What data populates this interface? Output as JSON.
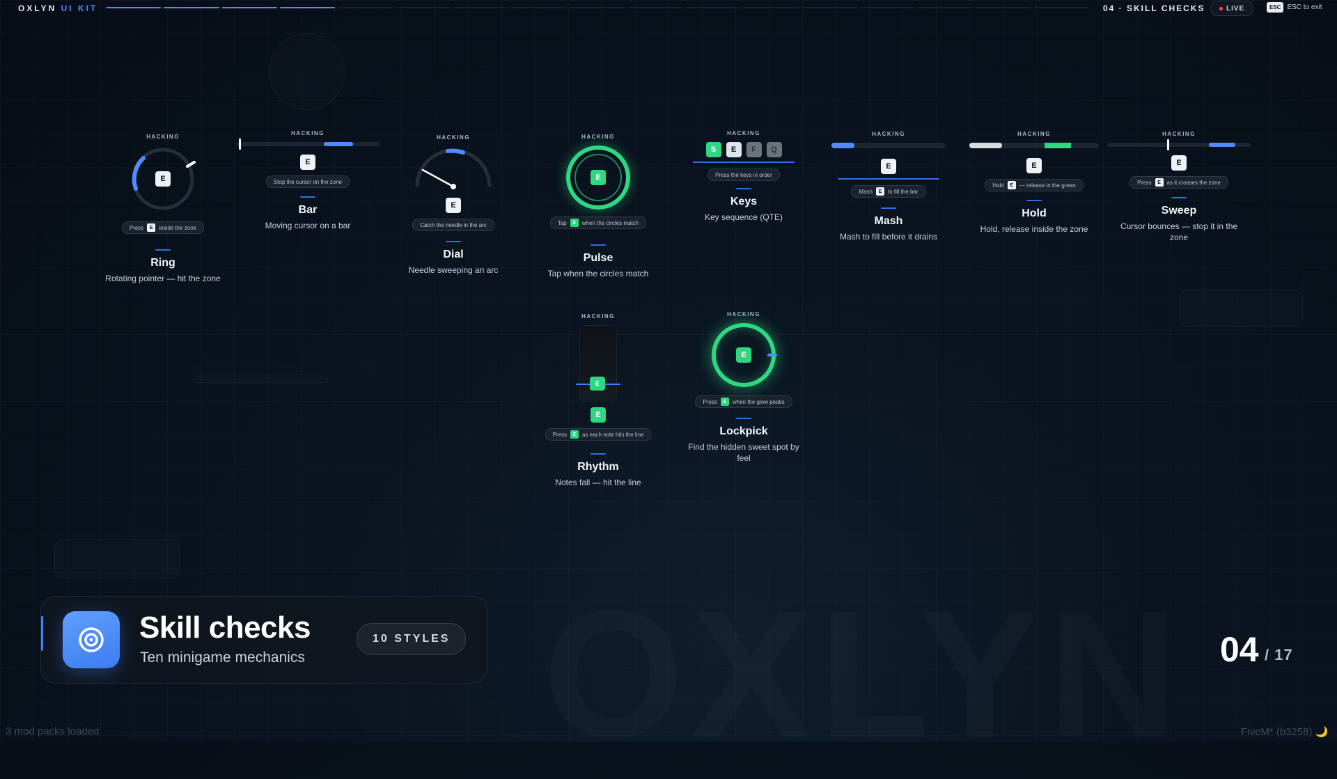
{
  "topbar": {
    "brand": "OXLYN",
    "brand_accent": "UI KIT",
    "section": "04 · SKILL CHECKS",
    "live": "LIVE",
    "esc_key": "ESC",
    "esc_label": "ESC to exit",
    "progress_total": 17,
    "progress_current": 4
  },
  "widgets": [
    {
      "id": "ring",
      "label": "HACKING",
      "key": "E",
      "hint_pre": "Press",
      "hint_key": "E",
      "hint_post": "inside the zone",
      "title": "Ring",
      "desc": "Rotating pointer — hit the zone"
    },
    {
      "id": "bar",
      "label": "HACKING",
      "key": "E",
      "hint": "Stop the cursor on the zone",
      "title": "Bar",
      "desc": "Moving cursor on a bar"
    },
    {
      "id": "dial",
      "label": "HACKING",
      "key": "E",
      "hint": "Catch the needle in the arc",
      "title": "Dial",
      "desc": "Needle sweeping an arc"
    },
    {
      "id": "pulse",
      "label": "HACKING",
      "key": "E",
      "hint_pre": "Tap",
      "hint_key": "E",
      "hint_post": "when the circles match",
      "title": "Pulse",
      "desc": "Tap when the circles match"
    },
    {
      "id": "keys",
      "label": "HACKING",
      "sequence": [
        "S",
        "E",
        "F",
        "Q"
      ],
      "hint": "Press the keys in order",
      "title": "Keys",
      "desc": "Key sequence (QTE)"
    },
    {
      "id": "mash",
      "label": "HACKING",
      "key": "E",
      "hint_pre": "Mash",
      "hint_key": "E",
      "hint_post": "to fill the bar",
      "title": "Mash",
      "desc": "Mash to fill before it drains"
    },
    {
      "id": "hold",
      "label": "HACKING",
      "key": "E",
      "hint_pre": "Hold",
      "hint_key": "E",
      "hint_post": "— release in the green",
      "title": "Hold",
      "desc": "Hold, release inside the zone"
    },
    {
      "id": "sweep",
      "label": "HACKING",
      "key": "E",
      "hint_pre": "Press",
      "hint_key": "E",
      "hint_post": "as it crosses the zone",
      "title": "Sweep",
      "desc": "Cursor bounces — stop it in the zone"
    },
    {
      "id": "rhythm",
      "label": "HACKING",
      "key": "E",
      "note_key": "E",
      "hint_pre": "Press",
      "hint_key": "E",
      "hint_post": "as each note hits the line",
      "title": "Rhythm",
      "desc": "Notes fall — hit the line"
    },
    {
      "id": "lockpick",
      "label": "HACKING",
      "key": "E",
      "hint_pre": "Press",
      "hint_key": "E",
      "hint_post": "when the glow peaks",
      "title": "Lockpick",
      "desc": "Find the hidden sweet spot by feel"
    }
  ],
  "card": {
    "title": "Skill checks",
    "subtitle": "Ten minigame mechanics",
    "badge": "10 STYLES",
    "icon": "target-icon"
  },
  "pager": {
    "current": "04",
    "total": "/ 17"
  },
  "footer": {
    "left": "3 mod packs loaded",
    "right": "FiveM* (b3258) 🌙"
  },
  "colors": {
    "accent": "#4f8cff",
    "success": "#2dd881",
    "live": "#ff4d5e"
  },
  "levels": {
    "bar_zone": 0.7,
    "mash_fill": 0.2,
    "hold_fill": 0.25
  }
}
